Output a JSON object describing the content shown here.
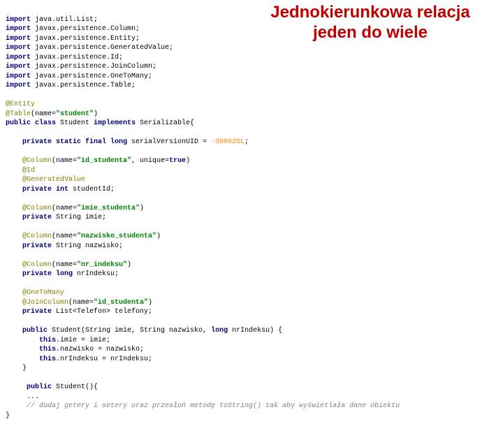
{
  "title_line1": "Jednokierunkowa relacja",
  "title_line2": "jeden do wiele",
  "code": {
    "imp1a": "import",
    "imp1b": " java.util.List;",
    "imp2a": "import",
    "imp2b": " javax.persistence.Column;",
    "imp3a": "import",
    "imp3b": " javax.persistence.Entity;",
    "imp4a": "import",
    "imp4b": " javax.persistence.GeneratedValue;",
    "imp5a": "import",
    "imp5b": " javax.persistence.Id;",
    "imp6a": "import",
    "imp6b": " javax.persistence.JoinColumn;",
    "imp7a": "import",
    "imp7b": " javax.persistence.OneToMany;",
    "imp8a": "import",
    "imp8b": " javax.persistence.Table;",
    "ann_entity": "@Entity",
    "ann_table_a": "@Table",
    "ann_table_b": "(name=",
    "ann_table_c": "\"student\"",
    "ann_table_d": ")",
    "cls_a": "public class",
    "cls_b": " Student ",
    "cls_c": "implements",
    "cls_d": " Serializable{",
    "svuid_a": "private static final long",
    "svuid_b": " serialVersionUID = ",
    "svuid_c": "-300025L",
    "svuid_d": ";",
    "col1_a": "@Column",
    "col1_b": "(name=",
    "col1_c": "\"id_studenta\"",
    "col1_d": ", unique=",
    "col1_e": "true",
    "col1_f": ")",
    "ann_id": "@Id",
    "ann_gv": "@GeneratedValue",
    "fld1_a": "private int",
    "fld1_b": " studentId;",
    "col2_a": "@Column",
    "col2_b": "(name=",
    "col2_c": "\"imie_studenta\"",
    "col2_d": ")",
    "fld2_a": "private",
    "fld2_b": " String imie;",
    "col3_a": "@Column",
    "col3_b": "(name=",
    "col3_c": "\"nazwisko_studenta\"",
    "col3_d": ")",
    "fld3_a": "private",
    "fld3_b": " String nazwisko;",
    "col4_a": "@Column",
    "col4_b": "(name=",
    "col4_c": "\"nr_indeksu\"",
    "col4_d": ")",
    "fld4_a": "private long",
    "fld4_b": " nrIndeksu;",
    "ann_otm": "@OneToMany",
    "jc_a": "@JoinColumn",
    "jc_b": "(name=",
    "jc_c": "\"id_studenta\"",
    "jc_d": ")",
    "fld5_a": "private",
    "fld5_b": " List<Telefon> telefony;",
    "ctor_a": "public",
    "ctor_b": " Student(String imie, String nazwisko, ",
    "ctor_c": "long",
    "ctor_d": " nrIndeksu) {",
    "ctor_l1a": "this",
    "ctor_l1b": ".imie = imie;",
    "ctor_l2a": "this",
    "ctor_l2b": ".nazwisko = nazwisko;",
    "ctor_l3a": "this",
    "ctor_l3b": ".nrIndeksu = nrIndeksu;",
    "ctor_close": "}",
    "ctor2_a": " public",
    "ctor2_b": " Student(){",
    "dots": " ...",
    "cmt": " // dodaj getery i setery oraz przesłoń metodę toString() tak aby wyświetlała dane obiektu",
    "close": "}"
  }
}
